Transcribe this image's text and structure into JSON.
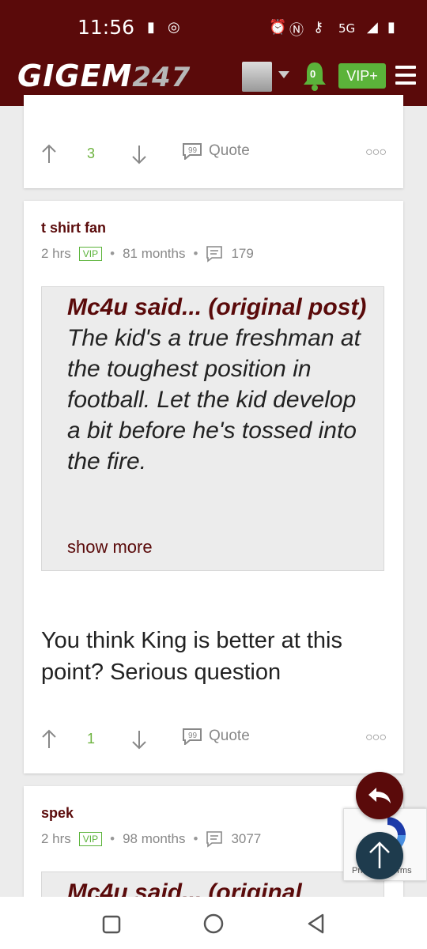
{
  "status": {
    "time": "11:56",
    "network": "5G"
  },
  "header": {
    "logo_main": "GIGEM",
    "logo_num": "247",
    "notification_count": "0",
    "vip_label": "VIP+"
  },
  "post_top": {
    "upvotes": "3",
    "quote_label": "Quote"
  },
  "post_main": {
    "username": "t shirt fan",
    "time": "2 hrs",
    "badge": "VIP",
    "tenure": "81 months",
    "post_count": "179",
    "quote_author": "Mc4u said... (original post)",
    "quote_body": "The kid's a true freshman at the toughest position in football. Let the kid develop a bit before he's tossed into the fire.",
    "show_more": "show more",
    "body": "You think King is better at this point? Serious question",
    "upvotes": "1",
    "quote_label": "Quote"
  },
  "post_next": {
    "username": "spek",
    "time": "2 hrs",
    "badge": "VIP",
    "tenure": "98 months",
    "post_count": "3077",
    "quote_author_partial": "Mc4u said... (original"
  },
  "recaptcha_text": "Privacy - Terms",
  "colors": {
    "brand": "#5a0a0a",
    "accent": "#5bb33a",
    "fab_scroll": "#1e3b4d"
  }
}
